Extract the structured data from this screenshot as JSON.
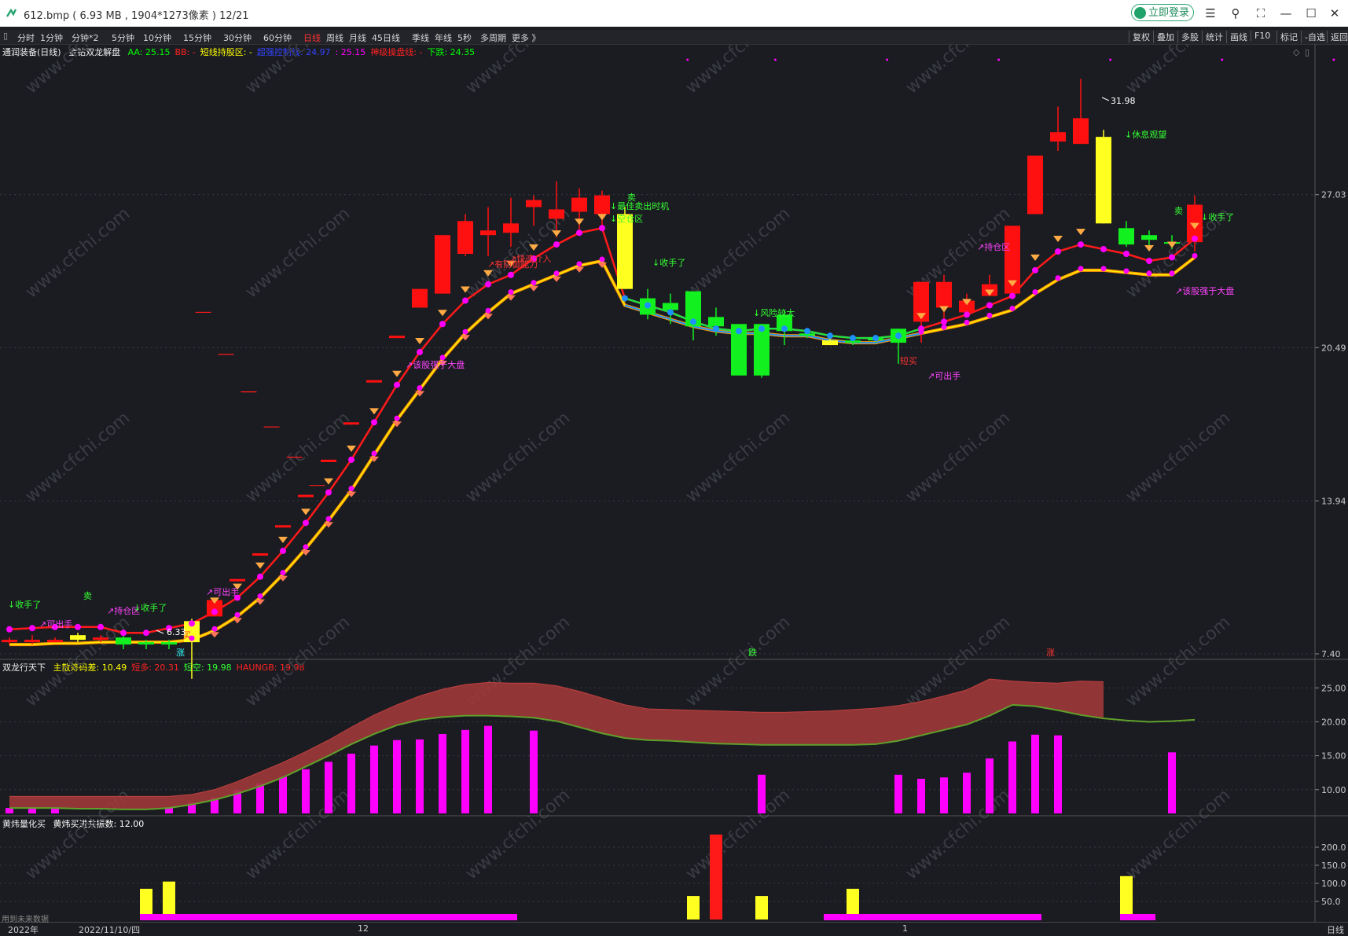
{
  "window": {
    "title": "612.bmp ( 6.93 MB , 1904*1273像素 ) 12/21",
    "login": "立即登录",
    "controls": [
      "menu-icon",
      "pin-icon",
      "fullscreen-icon",
      "minimize-icon",
      "maximize-icon",
      "close-icon"
    ]
  },
  "toolbar": {
    "periods": [
      "分时",
      "1分钟",
      "分钟*2",
      "5分钟",
      "10分钟",
      "15分钟",
      "30分钟",
      "60分钟",
      "日线",
      "周线",
      "月线",
      "45日线",
      "季线",
      "年线",
      "5秒",
      "多周期",
      "更多 》"
    ],
    "active_period": "日线",
    "right_items": [
      "复权",
      "叠加",
      "多股",
      "统计",
      "画线",
      "F10",
      "标记",
      "-自选",
      "返回"
    ]
  },
  "main_panel": {
    "stock": "通润装备",
    "period": "(日线)",
    "indicator": "金钻双龙解盘",
    "values": [
      {
        "label": "AA: 25.15",
        "color": "#00ff00"
      },
      {
        "label": "BB: -",
        "color": "#ff2222"
      },
      {
        "label": "短线持股区: -",
        "color": "#ffff00"
      },
      {
        "label": "超强控制线: 24.97",
        "color": "#3344ff"
      },
      {
        "label": ": 25.15",
        "color": "#ff00ff"
      },
      {
        "label": "神级操盘线: -",
        "color": "#ff2222"
      },
      {
        "label": "下跌: 24.35",
        "color": "#00ff00"
      }
    ],
    "price_axis": [
      "27.03",
      "20.49",
      "13.94",
      "7.40"
    ],
    "annotations": {
      "high": "31.98",
      "low": "6.33",
      "labels": [
        {
          "text": "↓收手了",
          "color": "#33ff33"
        },
        {
          "text": "卖",
          "color": "#33ff33"
        },
        {
          "text": "↗持仓区",
          "color": "#ff44ff"
        },
        {
          "text": "↓收手了",
          "color": "#33ff33"
        },
        {
          "text": "买",
          "color": "#ff3333"
        },
        {
          "text": "↗可出手",
          "color": "#ff44ff"
        },
        {
          "text": "↗可出手",
          "color": "#ff44ff"
        },
        {
          "text": "↗该股强于大盘",
          "color": "#ff44ff"
        },
        {
          "text": "↗有防御能力",
          "color": "#ff3333"
        },
        {
          "text": "↗快速介入",
          "color": "#ff3333"
        },
        {
          "text": "卖",
          "color": "#33ff33"
        },
        {
          "text": "↓最佳卖出时机",
          "color": "#33ff33"
        },
        {
          "text": "↓空仓区",
          "color": "#33ff33"
        },
        {
          "text": "↓收手了",
          "color": "#33ff33"
        },
        {
          "text": "↓风险较大",
          "color": "#33ff33"
        },
        {
          "text": "短买",
          "color": "#ff3333"
        },
        {
          "text": "↗可出手",
          "color": "#ff44ff"
        },
        {
          "text": "↗持仓区",
          "color": "#ff44ff"
        },
        {
          "text": "↓休息观望",
          "color": "#33ff33"
        },
        {
          "text": "卖",
          "color": "#33ff33"
        },
        {
          "text": "↓收手了",
          "color": "#33ff33"
        },
        {
          "text": "↗该股强于大盘",
          "color": "#ff44ff"
        },
        {
          "text": "涨",
          "color": "#33ffff"
        },
        {
          "text": "跌",
          "color": "#33ff33"
        },
        {
          "text": "涨",
          "color": "#ff3333"
        }
      ]
    },
    "watermark": "www.cfchi.com"
  },
  "panel2": {
    "name": "双龙行天下",
    "values": [
      {
        "label": "主散筹码差: 10.49",
        "color": "#ffff00"
      },
      {
        "label": "短多: 20.31",
        "color": "#ff2222"
      },
      {
        "label": "短空: 19.98",
        "color": "#33ff33"
      },
      {
        "label": "HAUNGB: 19.98",
        "color": "#ff2222"
      }
    ],
    "axis": [
      "25.00",
      "20.00",
      "15.00",
      "10.00"
    ]
  },
  "panel3": {
    "name": "黄炜量化买",
    "values": [
      {
        "label": "黄炜买进共振数: 12.00",
        "color": "#ffffff"
      }
    ],
    "axis": [
      "200.0",
      "150.0",
      "100.0",
      "50.0"
    ],
    "footer_note": "用到未来数据"
  },
  "date_axis": [
    "2022年",
    "2022/11/10/四",
    "12",
    "1",
    "日线"
  ],
  "chart_data": {
    "type": "candlestick",
    "candles": [
      {
        "o": 7.9,
        "c": 8.0,
        "h": 8.1,
        "l": 7.8,
        "col": "red"
      },
      {
        "o": 7.9,
        "c": 8.0,
        "h": 8.2,
        "l": 7.8,
        "col": "red"
      },
      {
        "o": 7.9,
        "c": 8.0,
        "h": 8.1,
        "l": 7.9,
        "col": "red"
      },
      {
        "o": 8.0,
        "c": 8.2,
        "h": 8.3,
        "l": 7.9,
        "col": "yellow"
      },
      {
        "o": 8.0,
        "c": 8.1,
        "h": 8.2,
        "l": 7.9,
        "col": "red"
      },
      {
        "o": 8.1,
        "c": 7.8,
        "h": 8.2,
        "l": 7.6,
        "col": "green"
      },
      {
        "o": 7.9,
        "c": 7.8,
        "h": 8.0,
        "l": 7.6,
        "col": "green"
      },
      {
        "o": 7.9,
        "c": 7.8,
        "h": 8.0,
        "l": 7.6,
        "col": "green"
      },
      {
        "o": 7.9,
        "c": 8.8,
        "h": 8.9,
        "l": 6.33,
        "col": "yellow"
      },
      {
        "o": 9.0,
        "c": 9.7,
        "h": 9.7,
        "l": 9.0,
        "col": "red"
      },
      {
        "o": 10.5,
        "c": 10.6,
        "h": 10.6,
        "l": 10.5,
        "col": "red"
      },
      {
        "o": 11.6,
        "c": 11.7,
        "h": 11.7,
        "l": 11.6,
        "col": "red"
      },
      {
        "o": 12.8,
        "c": 12.9,
        "h": 12.9,
        "l": 12.8,
        "col": "red"
      },
      {
        "o": 14.1,
        "c": 14.2,
        "h": 14.2,
        "l": 14.1,
        "col": "red"
      },
      {
        "o": 15.6,
        "c": 15.7,
        "h": 15.7,
        "l": 15.6,
        "col": "red"
      },
      {
        "o": 17.2,
        "c": 17.3,
        "h": 17.3,
        "l": 17.2,
        "col": "red"
      },
      {
        "o": 19.0,
        "c": 19.1,
        "h": 19.1,
        "l": 19.0,
        "col": "red"
      },
      {
        "o": 20.9,
        "c": 21.0,
        "h": 21.0,
        "l": 20.9,
        "col": "red"
      },
      {
        "o": 22.2,
        "c": 23.0,
        "h": 23.0,
        "l": 22.2,
        "col": "red"
      },
      {
        "o": 22.8,
        "c": 25.3,
        "h": 25.3,
        "l": 22.8,
        "col": "red"
      },
      {
        "o": 24.5,
        "c": 25.9,
        "h": 26.2,
        "l": 24.4,
        "col": "red"
      },
      {
        "o": 25.3,
        "c": 25.5,
        "h": 26.5,
        "l": 24.4,
        "col": "red"
      },
      {
        "o": 25.4,
        "c": 25.8,
        "h": 26.9,
        "l": 24.8,
        "col": "red"
      },
      {
        "o": 26.5,
        "c": 26.8,
        "h": 27.0,
        "l": 25.7,
        "col": "red"
      },
      {
        "o": 26.0,
        "c": 26.4,
        "h": 27.6,
        "l": 25.2,
        "col": "red"
      },
      {
        "o": 26.3,
        "c": 26.9,
        "h": 27.3,
        "l": 25.5,
        "col": "red"
      },
      {
        "o": 26.2,
        "c": 27.0,
        "h": 27.2,
        "l": 25.7,
        "col": "red"
      },
      {
        "o": 26.2,
        "c": 23.0,
        "h": 26.5,
        "l": 23.0,
        "col": "yellow"
      },
      {
        "o": 22.6,
        "c": 21.9,
        "h": 23.0,
        "l": 21.7,
        "col": "green"
      },
      {
        "o": 22.1,
        "c": 22.4,
        "h": 22.8,
        "l": 21.5,
        "col": "green"
      },
      {
        "o": 22.9,
        "c": 21.4,
        "h": 22.9,
        "l": 20.8,
        "col": "green"
      },
      {
        "o": 21.8,
        "c": 21.4,
        "h": 22.2,
        "l": 21.0,
        "col": "green"
      },
      {
        "o": 21.5,
        "c": 19.3,
        "h": 21.5,
        "l": 19.3,
        "col": "green"
      },
      {
        "o": 21.5,
        "c": 19.3,
        "h": 21.5,
        "l": 19.2,
        "col": "green"
      },
      {
        "o": 21.9,
        "c": 21.2,
        "h": 22.1,
        "l": 20.6,
        "col": "green"
      },
      {
        "o": 21.0,
        "c": 21.1,
        "h": 21.2,
        "l": 20.9,
        "col": "green"
      },
      {
        "o": 20.8,
        "c": 20.6,
        "h": 21.0,
        "l": 20.6,
        "col": "yellow"
      },
      {
        "o": 20.8,
        "c": 20.7,
        "h": 20.9,
        "l": 20.6,
        "col": "green"
      },
      {
        "o": 20.8,
        "c": 20.9,
        "h": 21.0,
        "l": 20.7,
        "col": "green"
      },
      {
        "o": 21.3,
        "c": 20.7,
        "h": 21.3,
        "l": 19.8,
        "col": "green"
      },
      {
        "o": 21.6,
        "c": 23.3,
        "h": 23.3,
        "l": 20.7,
        "col": "red"
      },
      {
        "o": 22.2,
        "c": 23.3,
        "h": 23.6,
        "l": 21.5,
        "col": "red"
      },
      {
        "o": 22.0,
        "c": 22.5,
        "h": 22.8,
        "l": 22.0,
        "col": "red"
      },
      {
        "o": 22.7,
        "c": 23.2,
        "h": 23.6,
        "l": 22.7,
        "col": "red"
      },
      {
        "o": 22.8,
        "c": 25.7,
        "h": 25.7,
        "l": 22.8,
        "col": "red"
      },
      {
        "o": 26.2,
        "c": 28.7,
        "h": 28.7,
        "l": 26.2,
        "col": "red"
      },
      {
        "o": 29.3,
        "c": 29.7,
        "h": 30.8,
        "l": 28.9,
        "col": "red"
      },
      {
        "o": 29.2,
        "c": 30.3,
        "h": 31.98,
        "l": 29.2,
        "col": "red"
      },
      {
        "o": 29.5,
        "c": 25.8,
        "h": 29.8,
        "l": 25.8,
        "col": "yellow"
      },
      {
        "o": 24.9,
        "c": 25.6,
        "h": 25.9,
        "l": 24.8,
        "col": "green"
      },
      {
        "o": 25.3,
        "c": 25.1,
        "h": 25.5,
        "l": 24.7,
        "col": "green"
      },
      {
        "o": 25.0,
        "c": 25.0,
        "h": 25.3,
        "l": 24.7,
        "col": "green"
      },
      {
        "o": 25.0,
        "c": 26.6,
        "h": 27.0,
        "l": 24.6,
        "col": "red"
      }
    ],
    "main_line": [
      8.45,
      8.5,
      8.55,
      8.55,
      8.55,
      8.3,
      8.3,
      8.5,
      8.7,
      9.2,
      9.8,
      10.7,
      11.8,
      13.0,
      14.3,
      15.7,
      17.3,
      18.9,
      20.3,
      21.5,
      22.5,
      23.2,
      23.6,
      24.3,
      24.9,
      25.4,
      25.6,
      22.6,
      22.3,
      22.0,
      21.6,
      21.3,
      21.2,
      21.3,
      21.3,
      21.2,
      21.0,
      20.9,
      20.9,
      21.0,
      21.3,
      21.6,
      21.9,
      22.3,
      22.7,
      23.8,
      24.6,
      24.9,
      24.7,
      24.5,
      24.2,
      24.35,
      25.15
    ],
    "lower_line": [
      7.8,
      7.8,
      7.85,
      7.85,
      7.9,
      7.9,
      7.9,
      7.9,
      8.0,
      8.4,
      9.0,
      9.8,
      10.8,
      11.9,
      13.1,
      14.4,
      15.9,
      17.4,
      18.7,
      20.0,
      21.1,
      22.0,
      22.8,
      23.2,
      23.6,
      24.0,
      24.2,
      22.3,
      22.0,
      21.7,
      21.4,
      21.2,
      21.1,
      21.1,
      21.0,
      21.0,
      20.8,
      20.7,
      20.7,
      20.9,
      21.1,
      21.3,
      21.5,
      21.8,
      22.1,
      22.8,
      23.4,
      23.8,
      23.8,
      23.7,
      23.6,
      23.6,
      24.35
    ],
    "panel2_bars": [
      7.3,
      7.3,
      7.3,
      0,
      0,
      0,
      0,
      7.3,
      8.1,
      8.8,
      9.9,
      10.9,
      11.9,
      13.0,
      14.1,
      15.3,
      16.5,
      17.3,
      17.4,
      18.2,
      18.8,
      19.4,
      0,
      18.7,
      0,
      0,
      0,
      0,
      0,
      0,
      0,
      0,
      0,
      12.2,
      0,
      0,
      0,
      0,
      0,
      12.2,
      11.6,
      11.8,
      12.5,
      14.6,
      17.1,
      18.1,
      18.0,
      0,
      0,
      0,
      0,
      15.5,
      0
    ],
    "panel2_upper": [
      9.0,
      9.0,
      9.0,
      9.0,
      9.0,
      9.0,
      9.0,
      9.0,
      9.3,
      10.0,
      11.2,
      12.6,
      14.0,
      15.6,
      17.3,
      19.2,
      21.0,
      22.5,
      23.8,
      24.8,
      25.5,
      25.8,
      25.7,
      25.7,
      25.3,
      24.5,
      23.5,
      22.5,
      21.9,
      21.8,
      21.7,
      21.6,
      21.5,
      21.4,
      21.4,
      21.5,
      21.6,
      21.8,
      22.0,
      22.4,
      23.0,
      23.8,
      24.7,
      26.3,
      26.0,
      25.8,
      25.7,
      26.0,
      25.9
    ],
    "panel2_lower": [
      7.3,
      7.3,
      7.3,
      7.2,
      7.2,
      7.1,
      7.1,
      7.3,
      7.8,
      8.5,
      9.4,
      10.5,
      11.8,
      13.4,
      15.0,
      16.7,
      18.2,
      19.5,
      20.3,
      20.7,
      20.9,
      20.9,
      20.8,
      20.6,
      20.1,
      19.2,
      18.3,
      17.6,
      17.3,
      17.2,
      17.0,
      16.8,
      16.7,
      16.6,
      16.6,
      16.6,
      16.6,
      16.6,
      16.7,
      17.2,
      18.0,
      18.8,
      19.6,
      20.9,
      22.5,
      22.3,
      21.7,
      21.0,
      20.5,
      20.2,
      20.0,
      20.1,
      20.3
    ],
    "panel3_bars": [
      {
        "i": 6,
        "v": 85,
        "col": "yellow"
      },
      {
        "i": 7,
        "v": 105,
        "col": "yellow"
      },
      {
        "i": 30,
        "v": 65,
        "col": "yellow"
      },
      {
        "i": 31,
        "v": 235,
        "col": "red"
      },
      {
        "i": 33,
        "v": 65,
        "col": "yellow"
      },
      {
        "i": 37,
        "v": 85,
        "col": "yellow"
      },
      {
        "i": 49,
        "v": 120,
        "col": "yellow"
      }
    ],
    "ylim_main": [
      7.4,
      33.0
    ],
    "ylim_panel2": [
      6.5,
      27.0
    ],
    "ylim_panel3": [
      0,
      250
    ]
  }
}
